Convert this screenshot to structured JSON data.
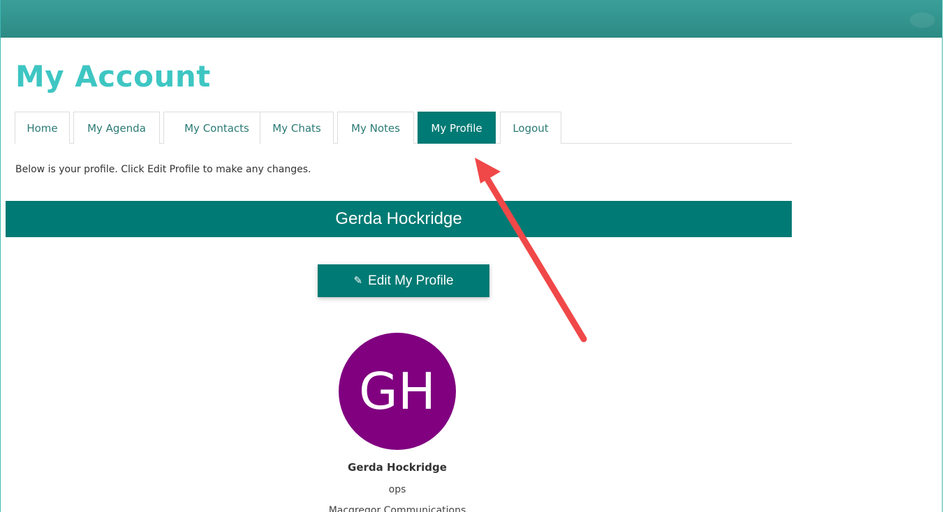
{
  "page": {
    "title": "My Account",
    "intro_text": "Below is your profile. Click Edit Profile to make any changes."
  },
  "tabs": [
    {
      "label": "Home",
      "active": false
    },
    {
      "label": "My Agenda",
      "active": false
    },
    {
      "label": "My Contacts",
      "active": false
    },
    {
      "label": "My Chats",
      "active": false
    },
    {
      "label": "My Notes",
      "active": false
    },
    {
      "label": "My Profile",
      "active": true
    },
    {
      "label": "Logout",
      "active": false
    }
  ],
  "profile": {
    "banner_name": "Gerda Hockridge",
    "edit_button_label": "Edit My Profile",
    "edit_button_icon": "edit-icon",
    "avatar_initials": "GH",
    "name": "Gerda Hockridge",
    "role": "ops",
    "company": "Macgregor Communications"
  },
  "colors": {
    "header_bar": "#2d8a84",
    "title": "#3ec6c3",
    "primary": "#007a74",
    "avatar": "#800080",
    "annotation_arrow": "#f04848"
  }
}
